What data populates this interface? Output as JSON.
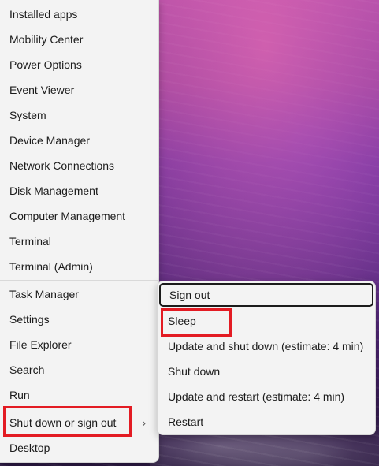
{
  "menu": {
    "items": [
      {
        "label": "Installed apps"
      },
      {
        "label": "Mobility Center"
      },
      {
        "label": "Power Options"
      },
      {
        "label": "Event Viewer"
      },
      {
        "label": "System"
      },
      {
        "label": "Device Manager"
      },
      {
        "label": "Network Connections"
      },
      {
        "label": "Disk Management"
      },
      {
        "label": "Computer Management"
      },
      {
        "label": "Terminal"
      },
      {
        "label": "Terminal (Admin)"
      },
      {
        "label": "Task Manager"
      },
      {
        "label": "Settings"
      },
      {
        "label": "File Explorer"
      },
      {
        "label": "Search"
      },
      {
        "label": "Run"
      },
      {
        "label": "Shut down or sign out",
        "chevron": "›"
      },
      {
        "label": "Desktop"
      }
    ]
  },
  "submenu": {
    "items": [
      {
        "label": "Sign out"
      },
      {
        "label": "Sleep"
      },
      {
        "label": "Update and shut down (estimate: 4 min)"
      },
      {
        "label": "Shut down"
      },
      {
        "label": "Update and restart (estimate: 4 min)"
      },
      {
        "label": "Restart"
      }
    ]
  },
  "annotations": {
    "highlight_color": "#e31b23",
    "highlighted": [
      "Shut down or sign out",
      "Sleep"
    ]
  }
}
